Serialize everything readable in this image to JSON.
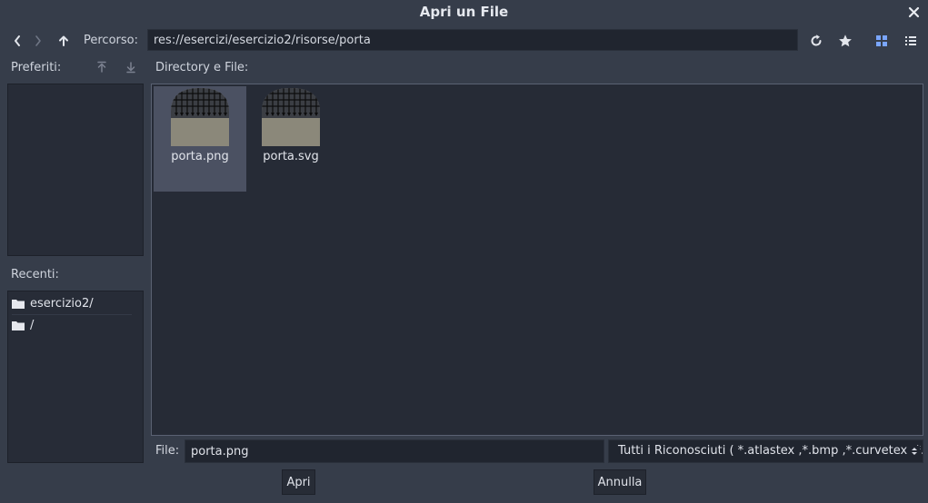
{
  "window": {
    "title": "Apri un File"
  },
  "toolbar": {
    "path_label": "Percorso:",
    "path_value": "res://esercizi/esercizio2/risorse/porta"
  },
  "favorites": {
    "label": "Preferiti:"
  },
  "recents": {
    "label": "Recenti:",
    "items": [
      {
        "label": "esercizio2/"
      },
      {
        "label": "/"
      }
    ]
  },
  "directory": {
    "label": "Directory e File:",
    "files": [
      {
        "name": "porta.png",
        "selected": true
      },
      {
        "name": "porta.svg",
        "selected": false
      }
    ]
  },
  "file_field": {
    "label": "File:",
    "value": "porta.png"
  },
  "filter": {
    "selected": "Tutti i Riconosciuti ( *.atlastex ,*.bmp ,*.curvetex ,*.dds"
  },
  "buttons": {
    "open": "Apri",
    "cancel": "Annulla"
  },
  "colors": {
    "background": "#363d4a",
    "panel": "#272c37",
    "input": "#20252f",
    "accent": "#7aa6ff",
    "selected": "#4b5162"
  }
}
